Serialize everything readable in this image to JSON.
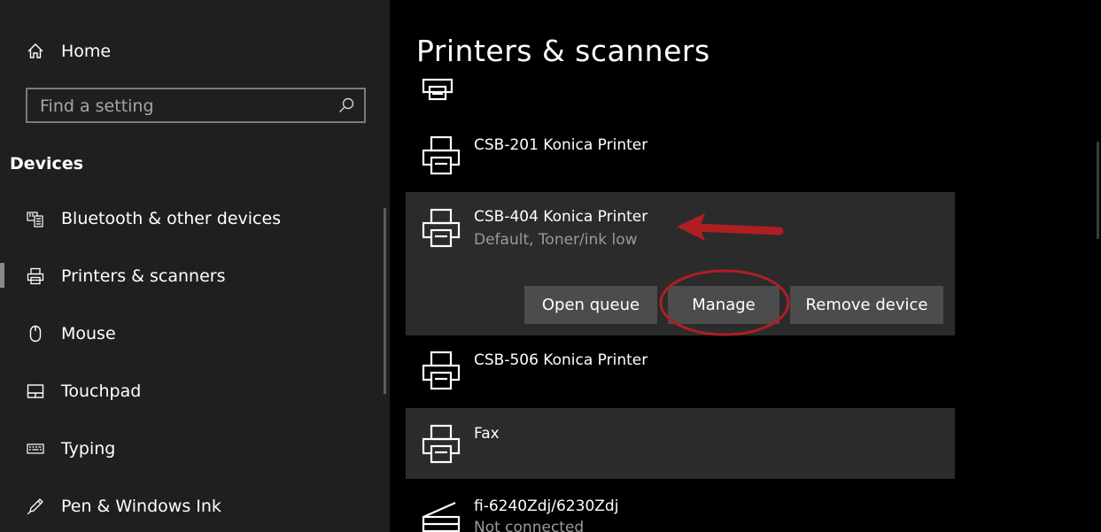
{
  "sidebar": {
    "home_label": "Home",
    "search_placeholder": "Find a setting",
    "section_title": "Devices",
    "items": [
      {
        "label": "Bluetooth & other devices",
        "icon": "bluetooth-devices-icon"
      },
      {
        "label": "Printers & scanners",
        "icon": "printer-icon",
        "selected": true
      },
      {
        "label": "Mouse",
        "icon": "mouse-icon"
      },
      {
        "label": "Touchpad",
        "icon": "touchpad-icon"
      },
      {
        "label": "Typing",
        "icon": "keyboard-icon"
      },
      {
        "label": "Pen & Windows Ink",
        "icon": "pen-icon"
      }
    ]
  },
  "main": {
    "title": "Printers & scanners",
    "printers": [
      {
        "name": "",
        "status": "",
        "icon": "printer-icon"
      },
      {
        "name": "CSB-201 Konica Printer",
        "status": "",
        "icon": "printer-icon"
      },
      {
        "name": "CSB-404 Konica Printer",
        "status": "Default, Toner/ink low",
        "icon": "printer-icon",
        "selected": true
      },
      {
        "name": "CSB-506 Konica Printer",
        "status": "",
        "icon": "printer-icon"
      },
      {
        "name": "Fax",
        "status": "",
        "icon": "printer-icon"
      },
      {
        "name": "fi-6240Zdj/6230Zdj",
        "status": "Not connected",
        "icon": "scanner-icon"
      }
    ],
    "actions": {
      "open_queue": "Open queue",
      "manage": "Manage",
      "remove_device": "Remove device"
    }
  },
  "colors": {
    "sidebar_bg": "#1f1f1f",
    "main_bg": "#000000",
    "selected_row_bg": "#2b2b2b",
    "button_bg": "#4c4c4c",
    "annotation_red": "#b01e24"
  }
}
